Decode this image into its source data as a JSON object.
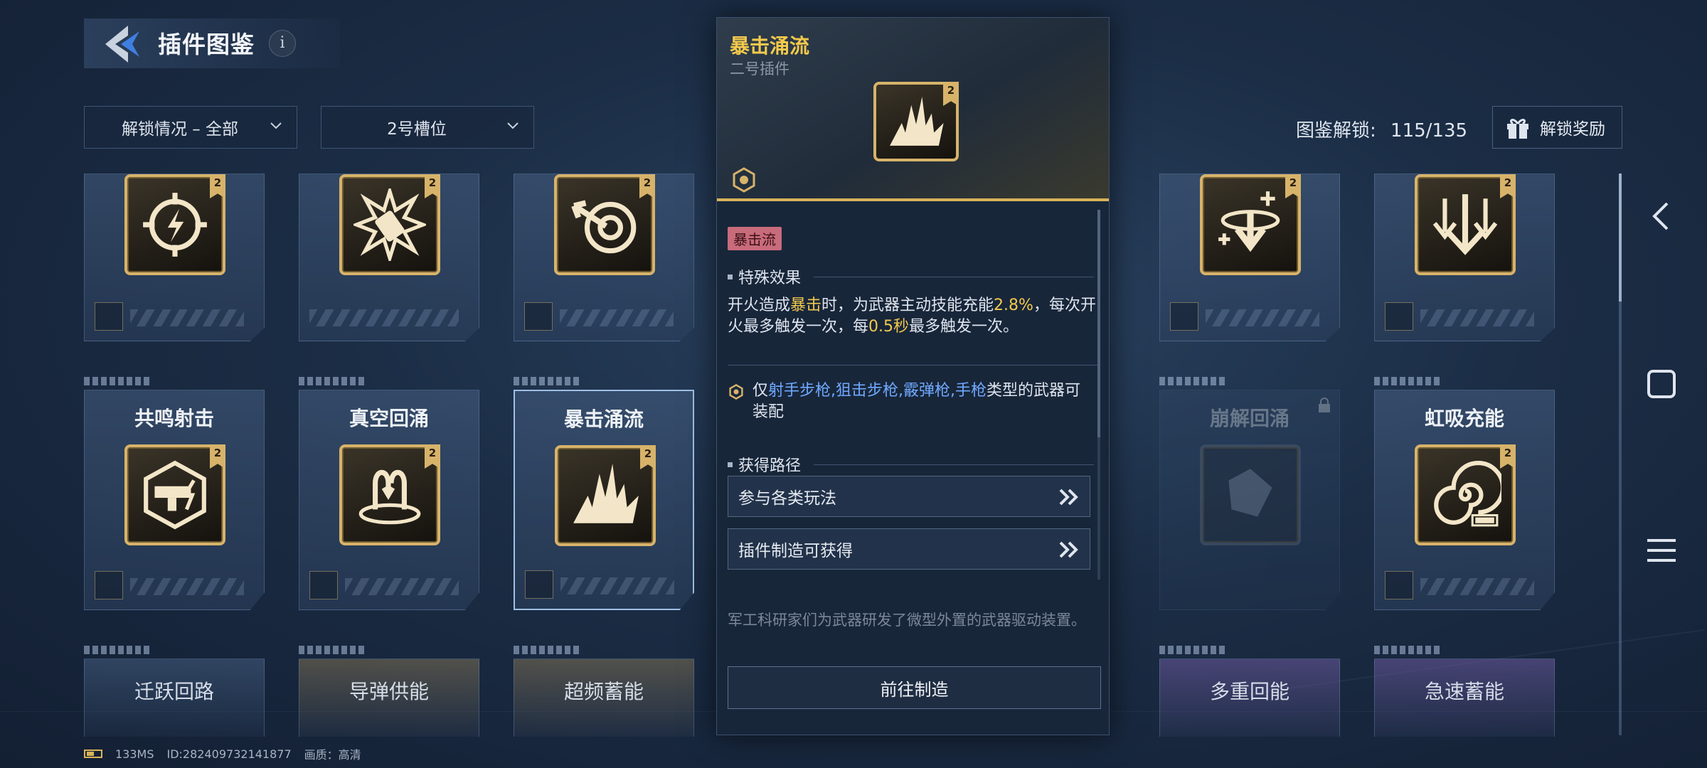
{
  "header": {
    "title": "插件图鉴",
    "info_label": "i"
  },
  "filters": {
    "unlock_filter": "解锁情况 – 全部",
    "slot_filter": "2号槽位"
  },
  "collection": {
    "label": "图鉴解锁:",
    "count": "115/135",
    "reward_button": "解锁奖励"
  },
  "cards_row1": [
    {
      "name": "",
      "icon": "lightning-crosshair-icon",
      "tier": "2"
    },
    {
      "name": "",
      "icon": "bullet-burst-icon",
      "tier": "2"
    },
    {
      "name": "",
      "icon": "target-arrow-icon",
      "tier": "2"
    },
    {
      "name": "",
      "icon": "hidden",
      "tier": ""
    },
    {
      "name": "",
      "icon": "hidden",
      "tier": ""
    },
    {
      "name": "",
      "icon": "down-arrow-plus-icon",
      "tier": "2"
    },
    {
      "name": "",
      "icon": "triple-arrow-down-icon",
      "tier": "2"
    }
  ],
  "cards_row2": [
    {
      "name": "共鸣射击",
      "icon": "resonance-gun-icon",
      "tier": "2"
    },
    {
      "name": "真空回涌",
      "icon": "vacuum-return-icon",
      "tier": "2"
    },
    {
      "name": "暴击涌流",
      "icon": "crit-surge-icon",
      "tier": "2"
    },
    {
      "name": "崩解回涌",
      "icon": "disintegrate-icon",
      "tier": ""
    },
    {
      "name": "虹吸充能",
      "icon": "siphon-spiral-icon",
      "tier": "2"
    }
  ],
  "cards_row3": [
    {
      "name": "迁跃回路"
    },
    {
      "name": "导弹供能"
    },
    {
      "name": "超频蓄能"
    },
    {
      "name": "多重回能"
    },
    {
      "name": "急速蓄能"
    }
  ],
  "detail": {
    "title": "暴击涌流",
    "subtitle": "二号插件",
    "tier": "2",
    "tag": "暴击流",
    "effect_heading": "特殊效果",
    "effect_p1": "开火造成",
    "effect_h1": "暴击",
    "effect_p2": "时，为武器主动技能充能",
    "effect_h2": "2.8%",
    "effect_p3": "，每次开火最多触发一次，每",
    "effect_h3": "0.5秒",
    "effect_p4": "最多触发一次。",
    "equip_prefix": "仅",
    "equip_weapons": "射手步枪,狙击步枪,霰弹枪,手枪",
    "equip_suffix": "类型的武器可装配",
    "source_heading": "获得路径",
    "source_1": "参与各类玩法",
    "source_2": "插件制造可获得",
    "description": "军工科研家们为武器研发了微型外置的武器驱动装置。",
    "action": "前往制造"
  },
  "status": {
    "ping": "133MS",
    "id": "ID:282409732141877",
    "quality": "画质：高清"
  },
  "colors": {
    "accent_gold": "#d7b36a",
    "highlight": "#f2c94c",
    "weapon_blue": "#6fa9ff",
    "tag_red": "#c86b7b"
  }
}
